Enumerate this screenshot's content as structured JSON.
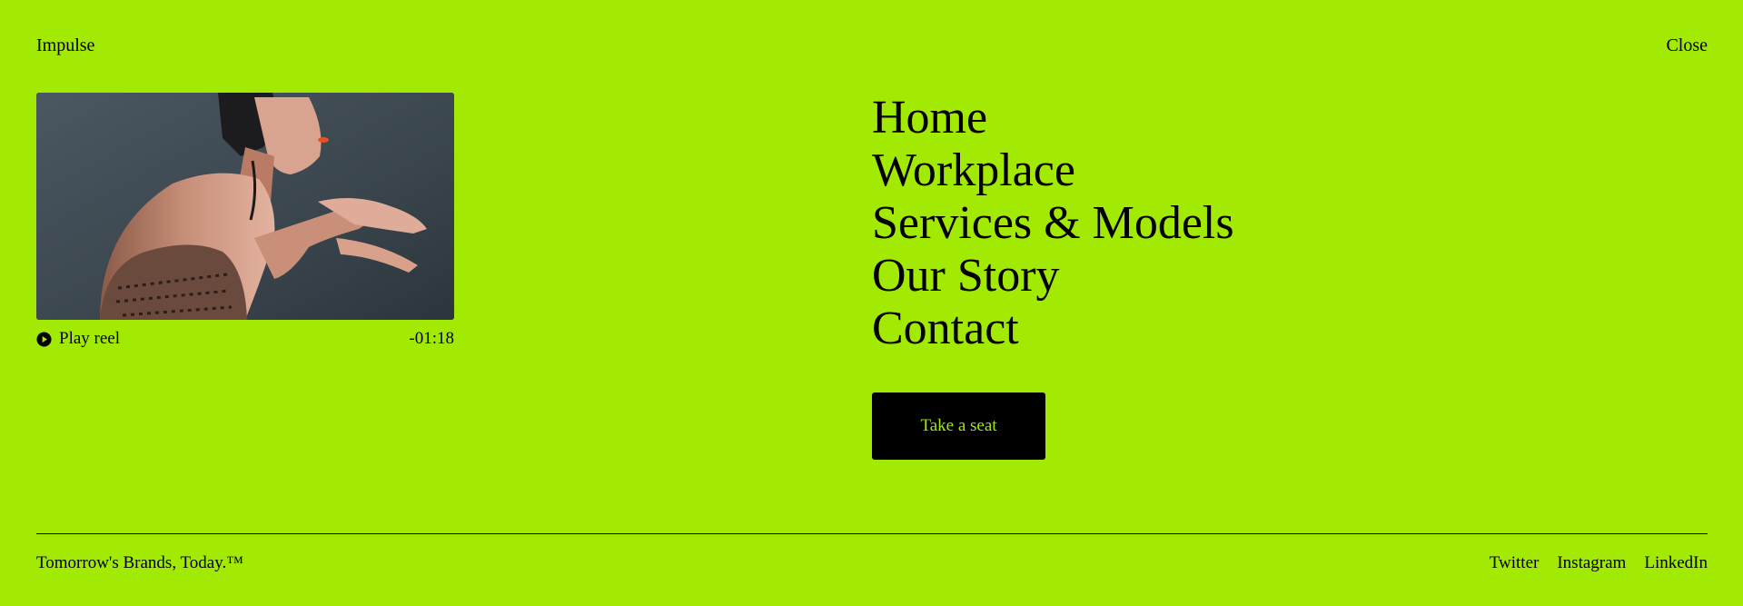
{
  "header": {
    "brand": "Impulse",
    "close_label": "Close"
  },
  "reel": {
    "play_label": "Play reel",
    "time_remaining": "-01:18",
    "play_icon": "play-circle-icon"
  },
  "nav": {
    "items": [
      {
        "label": "Home"
      },
      {
        "label": "Workplace"
      },
      {
        "label": "Services & Models"
      },
      {
        "label": "Our Story"
      },
      {
        "label": "Contact"
      }
    ]
  },
  "cta": {
    "label": "Take a seat"
  },
  "footer": {
    "tagline": "Tomorrow's Brands, Today.™",
    "social": [
      {
        "label": "Twitter"
      },
      {
        "label": "Instagram"
      },
      {
        "label": "LinkedIn"
      }
    ]
  },
  "colors": {
    "background": "#a2ea04",
    "text": "#000000",
    "button_bg": "#000000",
    "button_text": "#a2ea04"
  }
}
